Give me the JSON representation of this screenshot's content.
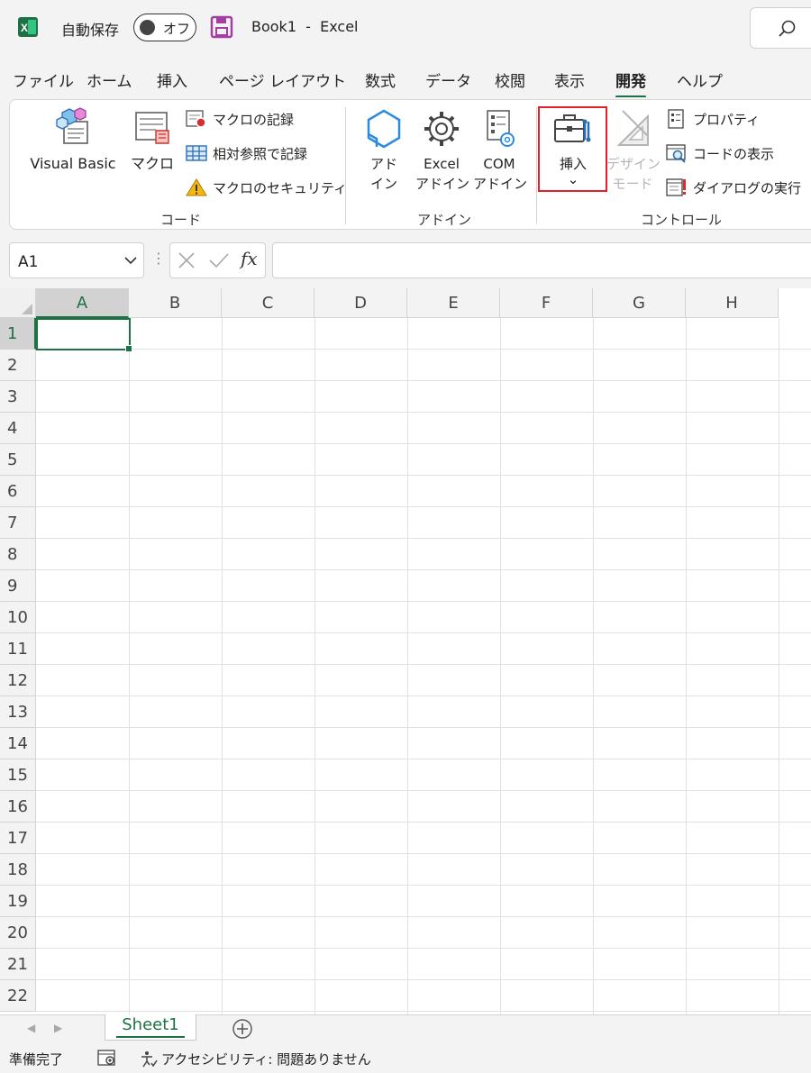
{
  "titlebar": {
    "autosave_label": "自動保存",
    "autosave_state": "オフ",
    "title": "Book1  -  Excel",
    "search_icon": "search-icon"
  },
  "tabs": [
    "ファイル",
    "ホーム",
    "挿入",
    "ページ レイアウト",
    "数式",
    "データ",
    "校閲",
    "表示",
    "開発",
    "ヘルプ"
  ],
  "active_tab": "開発",
  "ribbon": {
    "code": {
      "label": "コード",
      "visual_basic": "Visual Basic",
      "macro": "マクロ",
      "record_macro": "マクロの記録",
      "relative_ref": "相対参照で記録",
      "macro_security": "マクロのセキュリティ"
    },
    "addins": {
      "label": "アドイン",
      "addin_line1": "アド",
      "addin_line2": "イン",
      "excel_addin_line1": "Excel",
      "excel_addin_line2": "アドイン",
      "com_addin_line1": "COM",
      "com_addin_line2": "アドイン"
    },
    "controls": {
      "label": "コントロール",
      "insert": "挿入",
      "insert_chevron": "⌄",
      "design_mode_line1": "デザイン",
      "design_mode_line2": "モード",
      "properties": "プロパティ",
      "view_code": "コードの表示",
      "run_dialog": "ダイアログの実行"
    }
  },
  "formula_bar": {
    "name_box": "A1",
    "fx": "fx",
    "formula": ""
  },
  "grid": {
    "columns": [
      "A",
      "B",
      "C",
      "D",
      "E",
      "F",
      "G",
      "H"
    ],
    "rows": [
      "1",
      "2",
      "3",
      "4",
      "5",
      "6",
      "7",
      "8",
      "9",
      "10",
      "11",
      "12",
      "13",
      "14",
      "15",
      "16",
      "17",
      "18",
      "19",
      "20",
      "21",
      "22"
    ],
    "selected_cell": "A1"
  },
  "sheets": {
    "tabs": [
      "Sheet1"
    ],
    "active": "Sheet1"
  },
  "status": {
    "ready": "準備完了",
    "accessibility": "アクセシビリティ: 問題ありません"
  },
  "colors": {
    "accent_green": "#1e7145",
    "highlight_red": "#e0202a",
    "chrome_gray": "#f3f3f3"
  }
}
